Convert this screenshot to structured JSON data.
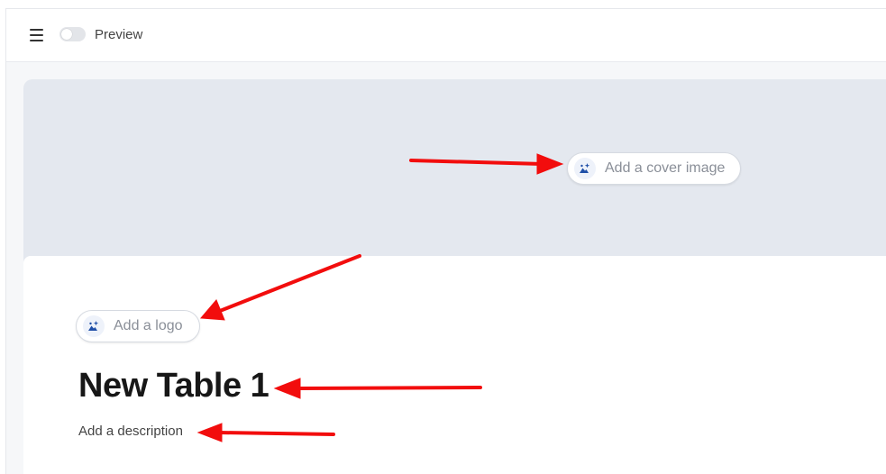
{
  "toolbar": {
    "menu_icon": "hamburger-menu-icon",
    "toggle_state": "off",
    "preview_label": "Preview"
  },
  "cover": {
    "add_cover_label": "Add a cover image",
    "icon": "sparkle-image-icon"
  },
  "header": {
    "add_logo_label": "Add a logo",
    "icon": "sparkle-image-icon",
    "title": "New Table 1",
    "description_placeholder": "Add a description"
  },
  "annotations": {
    "arrow_color": "#f20d0d"
  },
  "colors": {
    "cover_bg": "#e4e8ef",
    "accent_icon": "#1f4fa8"
  }
}
